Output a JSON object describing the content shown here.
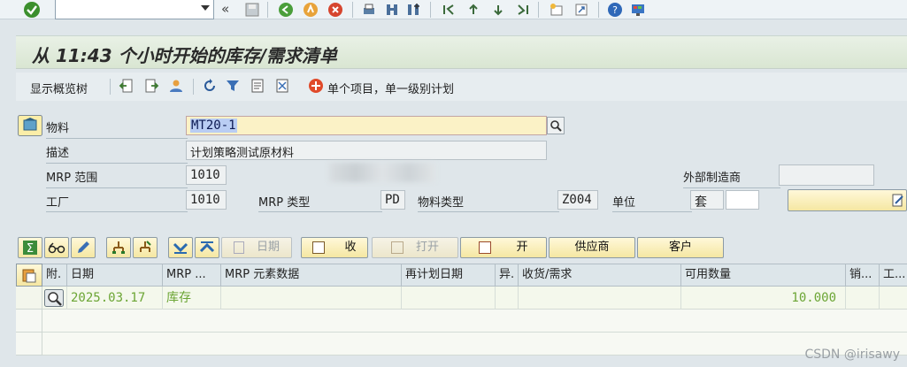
{
  "title": "从 11:43 个小时开始的库存/需求清单",
  "app_toolbar": {
    "display_tree": "显示概览树",
    "single_item_label": "单个项目，单一级别计划"
  },
  "header": {
    "material_label": "物料",
    "material_value": "MT20-1",
    "description_label": "描述",
    "description_value": "计划策略测试原材料",
    "mrp_area_label": "MRP 范围",
    "mrp_area_value": "1010",
    "plant_label": "工厂",
    "plant_value": "1010",
    "mrp_type_label": "MRP 类型",
    "mrp_type_value": "PD",
    "material_type_label": "物料类型",
    "material_type_value": "Z004",
    "unit_label": "单位",
    "unit_value": "套",
    "ext_mfr_label": "外部制造商"
  },
  "grid_buttons": {
    "date": "日期",
    "receive": "收",
    "open": "打开",
    "on": "开",
    "vendor": "供应商",
    "customer": "客户"
  },
  "table": {
    "columns": [
      "附.",
      "日期",
      "MRP ...",
      "MRP 元素数据",
      "再计划日期",
      "异.",
      "收货/需求",
      "可用数量",
      "销...",
      "工..."
    ],
    "rows": [
      {
        "date": "2025.03.17",
        "mrp_element": "库存",
        "available_qty": "10.000"
      }
    ]
  },
  "watermark": "CSDN @irisawy",
  "colors": {
    "title_bg": "#dce8d6",
    "accent_yellow": "#f5e7a2",
    "green_text": "#6ba534"
  }
}
